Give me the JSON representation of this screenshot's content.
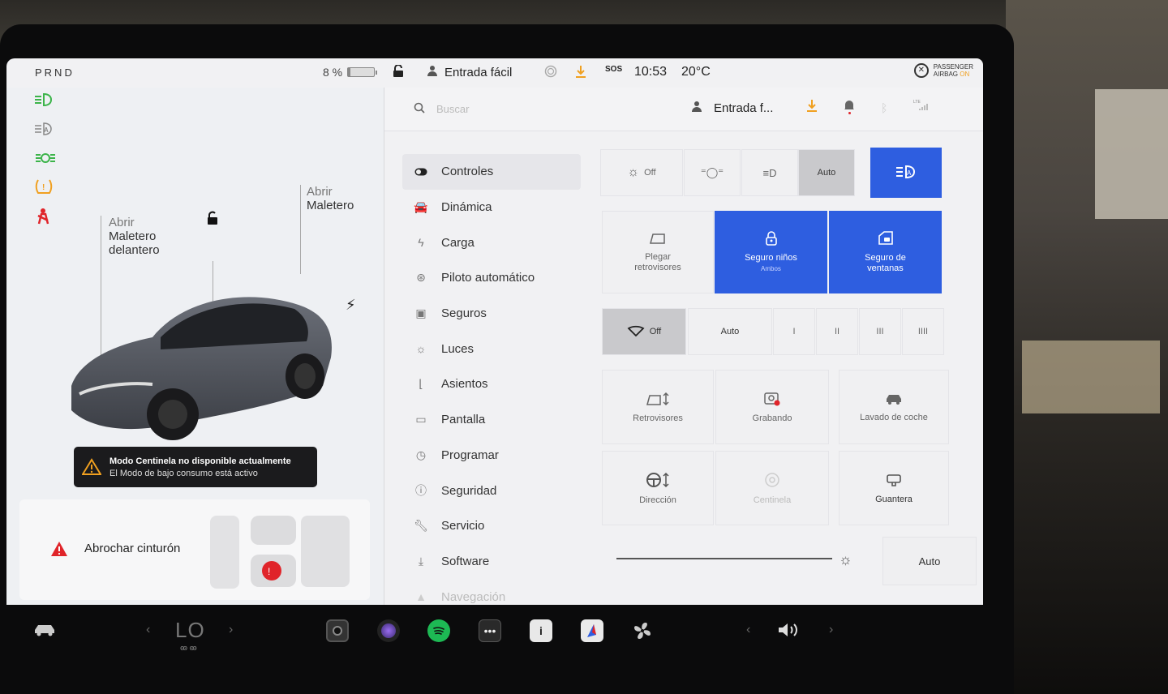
{
  "status": {
    "prnd": "PRND",
    "battery_pct": "8 %",
    "battery_level": 0.08,
    "profile": "Entrada fácil",
    "sos": "SOS",
    "time": "10:53",
    "temp": "20°C",
    "airbag_line1": "PASSENGER",
    "airbag_line2": "AIRBAG",
    "airbag_state": "ON"
  },
  "car_panel": {
    "frunk_line1": "Abrir",
    "frunk_line2": "Maletero",
    "frunk_line3": "delantero",
    "trunk_line1": "Abrir",
    "trunk_line2": "Maletero",
    "sentinel_title": "Modo Centinela no disponible actualmente",
    "sentinel_sub": "El Modo de bajo consumo está activo",
    "seatbelt": "Abrochar cinturón"
  },
  "topbar": {
    "search_placeholder": "Buscar",
    "profile": "Entrada f..."
  },
  "menu": [
    {
      "label": "Controles",
      "icon": "toggle-icon"
    },
    {
      "label": "Dinámica",
      "icon": "car-icon"
    },
    {
      "label": "Carga",
      "icon": "bolt-icon"
    },
    {
      "label": "Piloto automático",
      "icon": "steering-wheel-icon"
    },
    {
      "label": "Seguros",
      "icon": "lock-icon"
    },
    {
      "label": "Luces",
      "icon": "sun-icon"
    },
    {
      "label": "Asientos",
      "icon": "seat-icon"
    },
    {
      "label": "Pantalla",
      "icon": "display-icon"
    },
    {
      "label": "Programar",
      "icon": "clock-icon"
    },
    {
      "label": "Seguridad",
      "icon": "info-icon"
    },
    {
      "label": "Servicio",
      "icon": "wrench-icon"
    },
    {
      "label": "Software",
      "icon": "download-icon"
    },
    {
      "label": "Navegación",
      "icon": "navigation-icon"
    }
  ],
  "controls": {
    "lights_off": "Off",
    "lights_auto": "Auto",
    "fold_mirrors_1": "Plegar",
    "fold_mirrors_2": "retrovisores",
    "child_lock": "Seguro niños",
    "child_lock_sub": "Ambos",
    "window_lock_1": "Seguro de",
    "window_lock_2": "ventanas",
    "wipers_off": "Off",
    "wipers_auto": "Auto",
    "wiper_1": "I",
    "wiper_2": "II",
    "wiper_3": "III",
    "wiper_4": "IIII",
    "mirrors": "Retrovisores",
    "dashcam": "Grabando",
    "carwash": "Lavado de coche",
    "steering": "Dirección",
    "sentinel": "Centinela",
    "glovebox": "Guantera",
    "display_auto": "Auto"
  },
  "dock": {
    "climate": "LO"
  },
  "colors": {
    "accent_blue": "#2e5ee0",
    "warning_red": "#e0242a",
    "download_orange": "#f0a020",
    "spotify_green": "#1db954"
  }
}
